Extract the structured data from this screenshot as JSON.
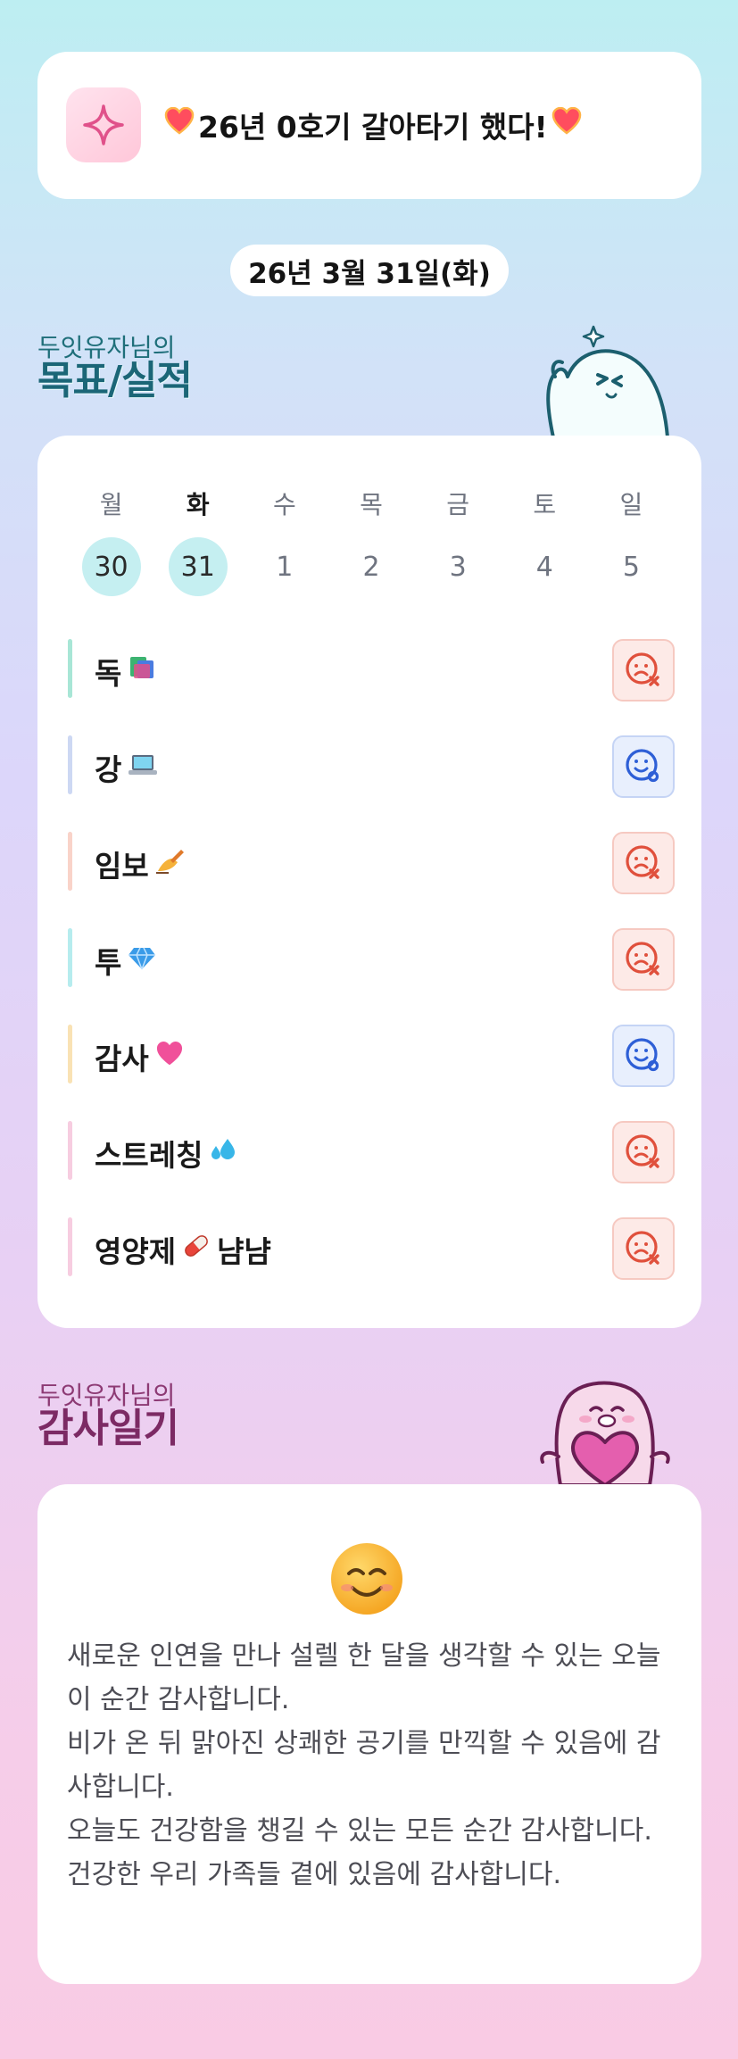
{
  "banner": {
    "text": "26년 0호기 갈아타기 했다!"
  },
  "date": "26년 3월 31일(화)",
  "goals_section": {
    "subtitle": "두잇유자님의",
    "title": "목표/실적"
  },
  "week": {
    "days": [
      {
        "name": "월",
        "num": "30",
        "highlight": true,
        "today": false
      },
      {
        "name": "화",
        "num": "31",
        "highlight": true,
        "today": true
      },
      {
        "name": "수",
        "num": "1",
        "highlight": false,
        "today": false
      },
      {
        "name": "목",
        "num": "2",
        "highlight": false,
        "today": false
      },
      {
        "name": "금",
        "num": "3",
        "highlight": false,
        "today": false
      },
      {
        "name": "토",
        "num": "4",
        "highlight": false,
        "today": false
      },
      {
        "name": "일",
        "num": "5",
        "highlight": false,
        "today": false
      }
    ]
  },
  "goals": [
    {
      "label": "독",
      "emoji": "books-icon",
      "after": "",
      "status": "fail",
      "bar_color": "#a8e6d6"
    },
    {
      "label": "강",
      "emoji": "laptop-icon",
      "after": "",
      "status": "ok",
      "bar_color": "#cdd8f3"
    },
    {
      "label": "임보",
      "emoji": "writing-hand-icon",
      "after": "",
      "status": "fail",
      "bar_color": "#f9d3c9"
    },
    {
      "label": "투",
      "emoji": "gem-icon",
      "after": "",
      "status": "fail",
      "bar_color": "#b6ecee"
    },
    {
      "label": "감사",
      "emoji": "pink-heart-icon",
      "after": "",
      "status": "ok",
      "bar_color": "#f9e2b4"
    },
    {
      "label": "스트레칭",
      "emoji": "sweat-droplets-icon",
      "after": "",
      "status": "fail",
      "bar_color": "#f7cde0"
    },
    {
      "label": "영양제",
      "emoji": "pill-icon",
      "after": "냠냠",
      "status": "fail",
      "bar_color": "#f7cde0"
    }
  ],
  "diary_section": {
    "subtitle": "두잇유자님의",
    "title": "감사일기"
  },
  "diary": {
    "emoji": "smiling-face-icon",
    "lines": [
      "새로운 인연을 만나 설렐 한 달을 생각할 수 있는 오늘 이 순간 감사합니다.",
      "비가 온 뒤 맑아진 상쾌한 공기를 만끽할 수 있음에 감사합니다.",
      "오늘도 건강함을 챙길 수 있는 모든 순간 감사합니다.",
      "건강한 우리 가족들 곁에 있음에 감사합니다."
    ]
  },
  "colors": {
    "teal_title": "#1b6677",
    "plum_title": "#7c2a64",
    "fail": "#e0503c",
    "ok": "#2e5fd6",
    "day_highlight": "#c5eff1"
  }
}
